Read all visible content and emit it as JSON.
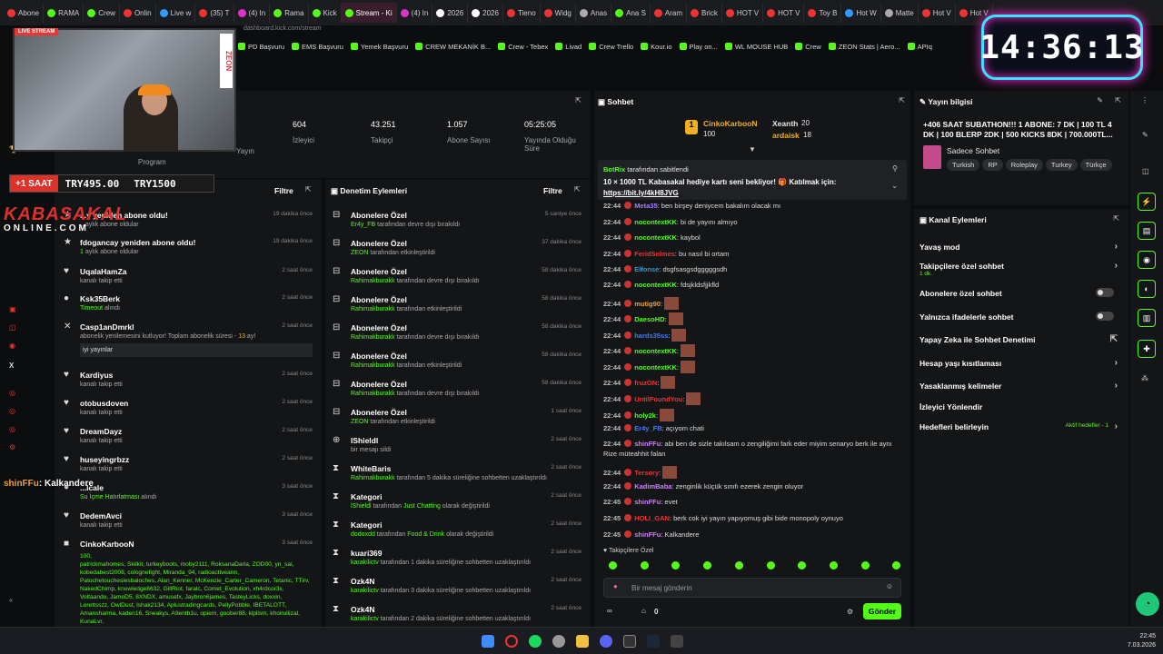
{
  "browser": {
    "tabs": [
      {
        "label": "Abone",
        "color": "#e33"
      },
      {
        "label": "RAMA",
        "color": "#53fc18"
      },
      {
        "label": "Crew",
        "color": "#53fc18"
      },
      {
        "label": "Onlin",
        "color": "#e33"
      },
      {
        "label": "Live w",
        "color": "#39f"
      },
      {
        "label": "(35) T",
        "color": "#e33"
      },
      {
        "label": "(4) In",
        "color": "#d3c"
      },
      {
        "label": "Rama",
        "color": "#53fc18"
      },
      {
        "label": "Kick",
        "color": "#53fc18"
      },
      {
        "label": "Stream - Ki",
        "color": "#53fc18",
        "active": true
      },
      {
        "label": "(4) In",
        "color": "#d3c"
      },
      {
        "label": "2026",
        "color": "#fff"
      },
      {
        "label": "2026",
        "color": "#fff"
      },
      {
        "label": "Tieno",
        "color": "#e33"
      },
      {
        "label": "Widg",
        "color": "#e33"
      },
      {
        "label": "Anas",
        "color": "#aaa"
      },
      {
        "label": "Ana S",
        "color": "#53fc18"
      },
      {
        "label": "Aram",
        "color": "#e33"
      },
      {
        "label": "Brick",
        "color": "#e33"
      },
      {
        "label": "HOT V",
        "color": "#e33"
      },
      {
        "label": "HOT V",
        "color": "#e33"
      },
      {
        "label": "Toy B",
        "color": "#e33"
      },
      {
        "label": "Hot W",
        "color": "#39f"
      },
      {
        "label": "Matte",
        "color": "#aaa"
      },
      {
        "label": "Hot V",
        "color": "#e33"
      },
      {
        "label": "Hot V",
        "color": "#e33"
      }
    ],
    "url": "dashboard.kick.com/stream",
    "bookmarks": [
      "PD Başvuru",
      "EMS Başvuru",
      "Yemek Başvuru",
      "CREW MEKANİK B...",
      "Crew - Tebex",
      "Livad",
      "Crew Trello",
      "Kour.io",
      "Play on...",
      "WL MOUSE HUB",
      "Crew",
      "ZEON Stats | Aero...",
      "APIq"
    ]
  },
  "overlay": {
    "clock": "14:36:13",
    "zeon": "ZEON",
    "live_badge": "LIVE STREAM",
    "sub_label": "+1 SAAT",
    "sub_value1": "TRY495.00",
    "sub_value2": "TRY1500",
    "logo_top": "KABASAKAL",
    "logo_bottom": "ONLINE.COM",
    "chat_line_user": "shinFFu",
    "chat_line_text": ": Kalkandere"
  },
  "stats": {
    "items": [
      {
        "value": "",
        "label": "Yayın"
      },
      {
        "value": "604",
        "label": "İzleyici"
      },
      {
        "value": "43.251",
        "label": "Takipçi"
      },
      {
        "value": "1.057",
        "label": "Abone Sayısı"
      },
      {
        "value": "05:25:05",
        "label": "Yayında Olduğu Süre"
      }
    ],
    "extra_label": "Program"
  },
  "feed": {
    "filter": "Filtre",
    "rows": [
      {
        "icon": "★",
        "title": "...y yeniden abone oldu!",
        "sub": "...aylık abone oldular",
        "time": "19 dakika önce"
      },
      {
        "icon": "★",
        "title": "fdogancay yeniden abone oldu!",
        "num": "1",
        "sub": " aylık abone oldular",
        "time": "19 dakika önce"
      },
      {
        "icon": "♥",
        "title": "UqalaHamZa",
        "sub": "kanalı takip etti",
        "time": "2 saat önce"
      },
      {
        "icon": "●",
        "title": "Ksk35Berk",
        "green": "Timeout",
        "sub": " alındı",
        "time": "2 saat önce"
      },
      {
        "icon": "✕",
        "title": "Casp1anDmrkl",
        "sub": "abonelik yenilemesini kutluyor! Toplam abonelik süresi - ",
        "num2": "13",
        "sub2": " ay!",
        "quote": "iyi yayınlar",
        "time": "2 saat önce"
      },
      {
        "icon": "♥",
        "title": "Kardiyus",
        "sub": "kanalı takip etti",
        "time": "2 saat önce"
      },
      {
        "icon": "♥",
        "title": "otobusdoven",
        "sub": "kanalı takip etti",
        "time": "2 saat önce"
      },
      {
        "icon": "♥",
        "title": "DreamDayz",
        "sub": "kanalı takip etti",
        "time": "2 saat önce"
      },
      {
        "icon": "♥",
        "title": "huseyingrbzz",
        "sub": "kanalı takip etti",
        "time": "2 saat önce"
      },
      {
        "icon": "●",
        "title": "...lcale",
        "green": "Su İçme Hatırlatması",
        "sub": " alındı",
        "time": "3 saat önce"
      },
      {
        "icon": "♥",
        "title": "DedemAvci",
        "sub": "kanalı takip etti",
        "time": "3 saat önce"
      },
      {
        "icon": "■",
        "title": "CinkoKarbooN",
        "time": "3 saat önce"
      }
    ],
    "gift_count": "100,",
    "gift_list": "patrickmahomes, Skilkit, turkeyboots, moby2111, RoksanaDaria, ZOD00, yn_sai, kobedabest2008, colognefight, Miranda_94, radioactivearm, Patochetoucheslesbaloches, Alan_Kenner, McKenzie_Carter_Cameron, Tetanic, TTirv, NakedChimp, knowledge8632, GillRiot, faralc, Comet_Evolution, xh4rdcor3x, Voltaando, JamoD5, 8XNDX, amusefx, Jaybron6james, TasteyLicks, doxxin, Lorettsszz, OwlDust, lshak2134, Aplustradingcards, PellyPobble, IBETALOTT, Amansharma, kaden16, Sneakys, A9entb1u, opiem, goober88, kiplism, khoiruliizal, KunaLvr,"
  },
  "moderation": {
    "title": "Denetim Eylemleri",
    "filter": "Filtre",
    "rows": [
      {
        "title": "Abonelere Özel",
        "actor": "Er4y_FB",
        "text": " tarafından devre dışı bırakıldı",
        "time": "5 saniye önce"
      },
      {
        "title": "Abonelere Özel",
        "actor": "ZEON",
        "text": " tarafından etkinleştirildi",
        "time": "37 dakika önce"
      },
      {
        "title": "Abonelere Özel",
        "actor": "Rahimakburakk",
        "text": " tarafından devre dışı bırakıldı",
        "time": "58 dakika önce"
      },
      {
        "title": "Abonelere Özel",
        "actor": "Rahimakburakk",
        "text": " tarafından etkinleştirildi",
        "time": "58 dakika önce"
      },
      {
        "title": "Abonelere Özel",
        "actor": "Rahimakburakk",
        "text": " tarafından devre dışı bırakıldı",
        "time": "58 dakika önce"
      },
      {
        "title": "Abonelere Özel",
        "actor": "Rahimakburakk",
        "text": " tarafından etkinleştirildi",
        "time": "58 dakika önce"
      },
      {
        "title": "Abonelere Özel",
        "actor": "Rahimakburakk",
        "text": " tarafından devre dışı bırakıldı",
        "time": "58 dakika önce"
      },
      {
        "title": "Abonelere Özel",
        "actor": "ZEON",
        "text": " tarafından etkinleştirildi",
        "time": "1 saat önce"
      },
      {
        "title": "lShieldl",
        "actor": "",
        "text": "bir mesajı sildi",
        "time": "2 saat önce"
      },
      {
        "title": "WhiteBaris",
        "actor": "Rahimakburakk",
        "text": " tarafından 5 dakika süreliğine sohbetten uzaklaştırıldı",
        "time": "2 saat önce"
      },
      {
        "title": "Kategori",
        "actor": "lShieldl",
        "text": " tarafından ",
        "green2": "Just Chatting",
        "text2": " olarak değiştirildi",
        "time": "2 saat önce"
      },
      {
        "title": "Kategori",
        "actor": "dodoxdd",
        "text": " tarafından ",
        "green2": "Food & Drink",
        "text2": " olarak değiştirildi",
        "time": "2 saat önce"
      },
      {
        "title": "kuari369",
        "actor": "karakilictv",
        "text": " tarafından 1 dakika süreliğine sohbetten uzaklaştırıldı",
        "time": "2 saat önce"
      },
      {
        "title": "Ozk4N",
        "actor": "karakilictv",
        "text": " tarafından 3 dakika süreliğine sohbetten uzaklaştırıldı",
        "time": "2 saat önce"
      },
      {
        "title": "Ozk4N",
        "actor": "karakilictv",
        "text": " tarafından 2 dakika süreliğine sohbetten uzaklaştırıldı",
        "time": "2 saat önce"
      }
    ]
  },
  "chat": {
    "title": "Sohbet",
    "leaders": [
      {
        "name": "CinkoKarbooN",
        "value": "100"
      },
      {
        "name": "Xeanth",
        "value": "20"
      },
      {
        "name": "ardaisk",
        "value": "18"
      }
    ],
    "pinned_user": "BotRix",
    "pinned_by": " tarafından sabitlendi",
    "pinned_text": "10 × 1000 TL Kabasakal hediye kartı seni bekliyor! 🎁 Katılmak için:",
    "pinned_link": "https://bit.ly/4kH8JVG",
    "messages": [
      {
        "time": "22:44",
        "user": "Meta35",
        "color": "#a37cff",
        "text": ": ben birşey deniycem bakalım olacak mı"
      },
      {
        "time": "22:44",
        "user": "nocontextKK",
        "color": "#53fc18",
        "text": ": bi de yayını almıyo"
      },
      {
        "time": "22:44",
        "user": "nocontextKK",
        "color": "#53fc18",
        "text": ": kaybol"
      },
      {
        "time": "22:44",
        "user": "FeridSelmes",
        "color": "#e33",
        "text": ": bu nasıl bi ortam"
      },
      {
        "time": "22:44",
        "user": "Elfonse",
        "color": "#39c",
        "text": ": dsgfsasgsdgggggsdh"
      },
      {
        "time": "22:44",
        "user": "nocontextKK",
        "color": "#53fc18",
        "text": ": fdsjkldsfjjkfld"
      },
      {
        "time": "22:44",
        "user": "mutig90",
        "color": "#f0a030",
        "text": ":"
      },
      {
        "time": "22:44",
        "user": "DaesoHD",
        "color": "#53fc18",
        "text": ":"
      },
      {
        "time": "22:44",
        "user": "hards35ss",
        "color": "#3d7cff",
        "text": ":"
      },
      {
        "time": "22:44",
        "user": "nocontextKK",
        "color": "#53fc18",
        "text": ":"
      },
      {
        "time": "22:44",
        "user": "nocontextKK",
        "color": "#53fc18",
        "text": ":"
      },
      {
        "time": "22:44",
        "user": "fruzON",
        "color": "#e33",
        "text": ":"
      },
      {
        "time": "22:44",
        "user": "UntilFoundYou",
        "color": "#e33",
        "text": ":"
      },
      {
        "time": "22:44",
        "user": "holy2k",
        "color": "#53fc18",
        "text": ":"
      },
      {
        "time": "22:44",
        "user": "Er4y_FB",
        "color": "#3d7cff",
        "text": ": açıyom chati"
      },
      {
        "time": "22:44",
        "user": "shinFFu",
        "color": "#d27cff",
        "text": ": abi ben de sizle takılsam o zengiliğimi fark eder miyim senaryo berk ile aynı Rize müteahhit falan"
      },
      {
        "time": "22:44",
        "user": "Tersory",
        "color": "#e33",
        "text": ":"
      },
      {
        "time": "22:44",
        "user": "KadimBaba",
        "color": "#d27cff",
        "text": ": zenginlik küçük sınıfı ezerek zengin oluyor"
      },
      {
        "time": "22:45",
        "user": "shinFFu",
        "color": "#d27cff",
        "text": ": evet"
      },
      {
        "time": "22:45",
        "user": "HOLI_GAN",
        "color": "#e33",
        "text": ": berk cok iyi yayın yapıyomuş gibi bide monopoly oynuyo"
      },
      {
        "time": "22:45",
        "user": "shinFFu",
        "color": "#d27cff",
        "text": ": Kalkandere"
      }
    ],
    "follower_only": "Takipçilere Özel",
    "placeholder": "Bir mesaj gönderin",
    "points": "0",
    "send": "Gönder"
  },
  "info": {
    "title": "Yayın bilgisi",
    "stream_title": "+406 SAAT SUBATHON!!! 1 ABONE: 7 DK | 100 TL 4 DK | 100 BLERP 2DK | 500 KICKS 8DK | 700.000TL...",
    "category": "Sadece Sohbet",
    "tags": [
      "Turkish",
      "RP",
      "Roleplay",
      "Turkey",
      "Türkçe"
    ]
  },
  "actions": {
    "title": "Kanal Eylemleri",
    "items": [
      {
        "label": "Yavaş mod",
        "type": "chev"
      },
      {
        "label": "Takipçilere özel sohbet",
        "sub": "1 dk.",
        "type": "chev"
      },
      {
        "label": "Abonelere özel sohbet",
        "type": "toggle"
      },
      {
        "label": "Yalnızca ifadelerle sohbet",
        "type": "toggle"
      },
      {
        "label": "Yapay Zeka ile Sohbet Denetimi",
        "type": "ext"
      },
      {
        "label": "Hesap yaşı kısıtlaması",
        "type": "chev"
      },
      {
        "label": "Yasaklanmış kelimeler",
        "type": "chev"
      },
      {
        "label": "İzleyici Yönlendir",
        "type": "none"
      },
      {
        "label": "Hedefleri belirleyin",
        "sub": "Aktif hedefler - 1",
        "type": "chev"
      }
    ]
  },
  "taskbar": {
    "time": "22:45",
    "date": "7.03.2026"
  },
  "colors": {
    "accent": "#53fc18",
    "bg": "#141517",
    "page": "#0b0d0f"
  }
}
